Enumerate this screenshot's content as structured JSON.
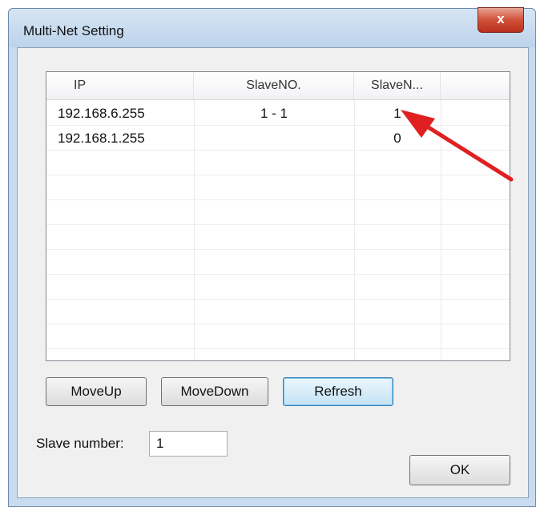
{
  "window": {
    "title": "Multi-Net Setting",
    "close_glyph": "x"
  },
  "list": {
    "columns": [
      "IP",
      "SlaveNO.",
      "SlaveN..."
    ],
    "rows": [
      {
        "ip": "192.168.6.255",
        "slave_no": "1 - 1",
        "slave_n": "1"
      },
      {
        "ip": "192.168.1.255",
        "slave_no": "",
        "slave_n": "0"
      }
    ]
  },
  "buttons": {
    "move_up": "MoveUp",
    "move_down": "MoveDown",
    "refresh": "Refresh",
    "ok": "OK"
  },
  "slave_number": {
    "label": "Slave number:",
    "value": "1"
  },
  "colors": {
    "arrow": "#e02020",
    "window_frame": "#c9dbee"
  }
}
